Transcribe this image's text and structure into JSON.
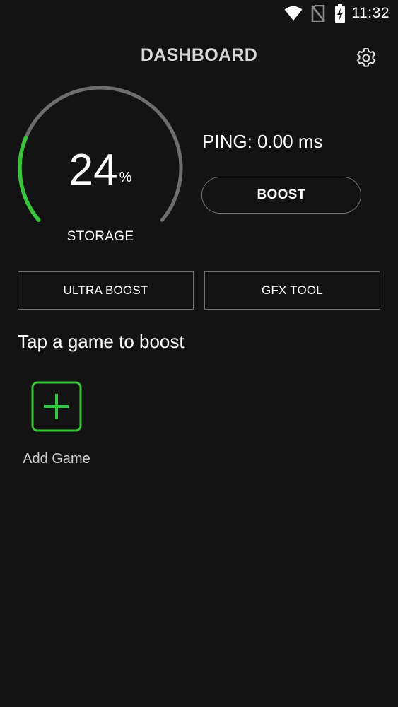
{
  "status_bar": {
    "time": "11:32",
    "icons": [
      "wifi-icon",
      "no-sim-icon",
      "battery-charging-icon"
    ]
  },
  "header": {
    "title": "DASHBOARD",
    "settings_icon": "gear-icon"
  },
  "gauge": {
    "value": "24",
    "unit": "%",
    "label": "STORAGE",
    "fraction": 0.24,
    "track_color": "#6e6e6e",
    "fill_color": "#39c33a"
  },
  "ping": {
    "text": "PING: 0.00 ms"
  },
  "buttons": {
    "boost": "BOOST",
    "ultra_boost": "ULTRA BOOST",
    "gfx_tool": "GFX TOOL"
  },
  "games": {
    "heading": "Tap a game to boost",
    "add_label": "Add Game",
    "add_icon": "plus-icon",
    "accent_color": "#39c33a"
  }
}
